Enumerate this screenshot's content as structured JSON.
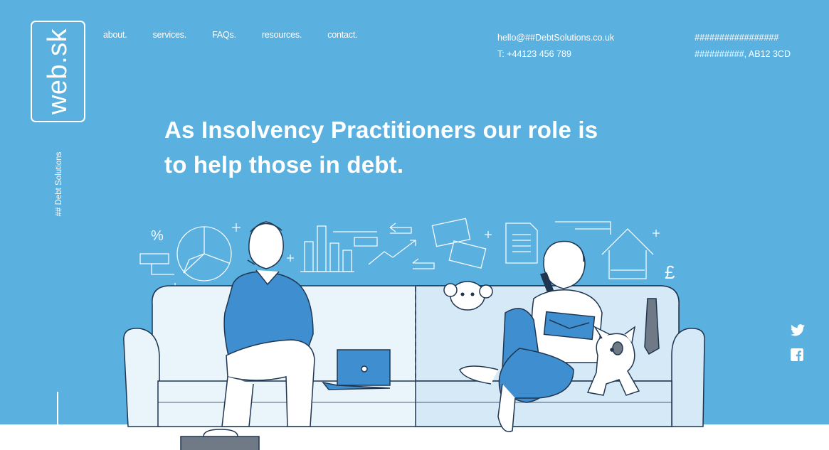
{
  "brand": {
    "logo_text": "web.sk",
    "tagline": "## Debt Solutions"
  },
  "nav": {
    "items": [
      {
        "label": "about."
      },
      {
        "label": "services."
      },
      {
        "label": "FAQs."
      },
      {
        "label": "resources."
      },
      {
        "label": "contact."
      }
    ]
  },
  "contact": {
    "email": "hello@##DebtSolutions.co.uk",
    "phone": "T: +44123 456 789"
  },
  "address": {
    "line1": "#################",
    "line2": "##########, AB12 3CD"
  },
  "hero": {
    "headline_line1": "As Insolvency Practitioners our role is",
    "headline_line2": "to help those in debt."
  },
  "social": {
    "icons": [
      "twitter-icon",
      "facebook-icon"
    ]
  },
  "colors": {
    "background": "#5ab0df",
    "accent_blue": "#3f8fd0",
    "sofa_left": "#eaf4fb",
    "sofa_right": "#d6e9f7",
    "line": "#1f3550"
  }
}
